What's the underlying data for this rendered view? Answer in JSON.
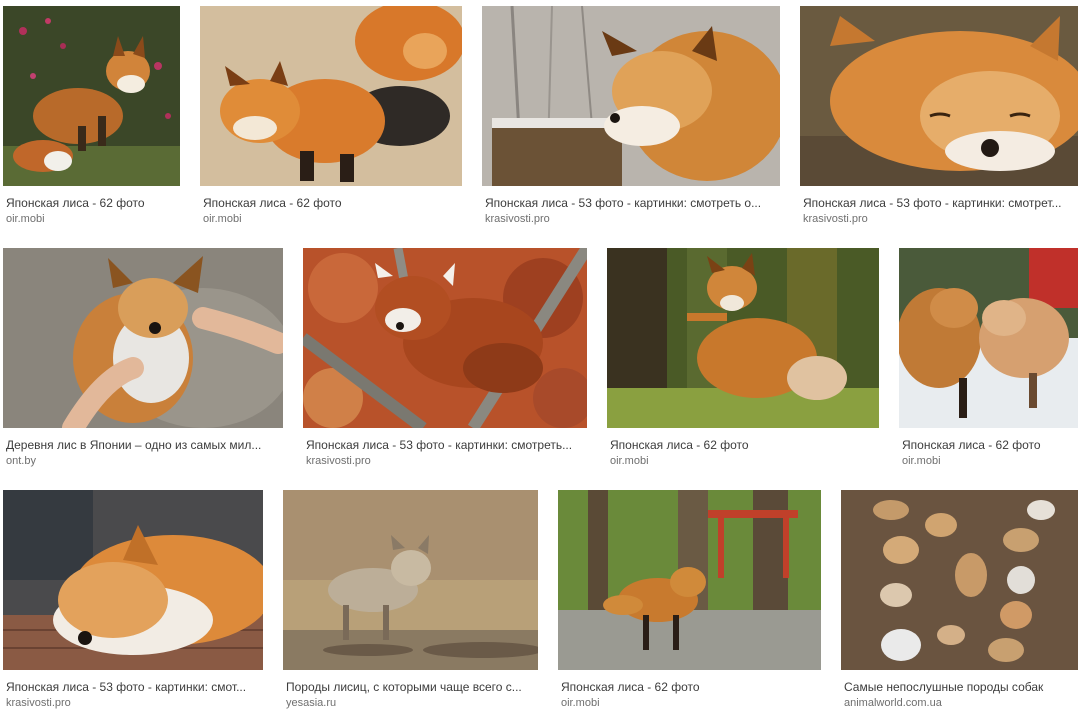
{
  "results": [
    {
      "title": "Японская лиса - 62 фото",
      "source": "oir.mobi",
      "image": "fox-in-garden-photo"
    },
    {
      "title": "Японская лиса - 62 фото",
      "source": "oir.mobi",
      "image": "two-foxes-resting-photo"
    },
    {
      "title": "Японская лиса - 53 фото - картинки: смотреть о...",
      "source": "krasivosti.pro",
      "image": "fox-closeup-on-stump-photo"
    },
    {
      "title": "Японская лиса - 53 фото - картинки: смотрет...",
      "source": "krasivosti.pro",
      "image": "sleeping-fox-closeup-photo"
    },
    {
      "title": "Деревня лис в Японии – одно из самых мил...",
      "source": "ont.by",
      "image": "fox-being-petted-photo"
    },
    {
      "title": "Японская лиса - 53 фото - картинки: смотреть...",
      "source": "krasivosti.pro",
      "image": "red-panda-in-tree-photo"
    },
    {
      "title": "Японская лиса - 62 фото",
      "source": "oir.mobi",
      "image": "fox-climbing-tree-photo"
    },
    {
      "title": "Японская лиса - 62 фото",
      "source": "oir.mobi",
      "image": "two-foxes-in-snow-photo"
    },
    {
      "title": "Японская лиса - 53 фото - картинки: смот...",
      "source": "krasivosti.pro",
      "image": "fox-sleeping-on-deck-photo"
    },
    {
      "title": "Породы лисиц, с которыми чаще всего с...",
      "source": "yesasia.ru",
      "image": "grey-fox-standing-photo"
    },
    {
      "title": "Японская лиса - 62 фото",
      "source": "oir.mobi",
      "image": "fox-in-forest-photo"
    },
    {
      "title": "Самые непослушные породы собак",
      "source": "animalworld.com.ua",
      "image": "many-foxes-from-above-photo"
    }
  ]
}
